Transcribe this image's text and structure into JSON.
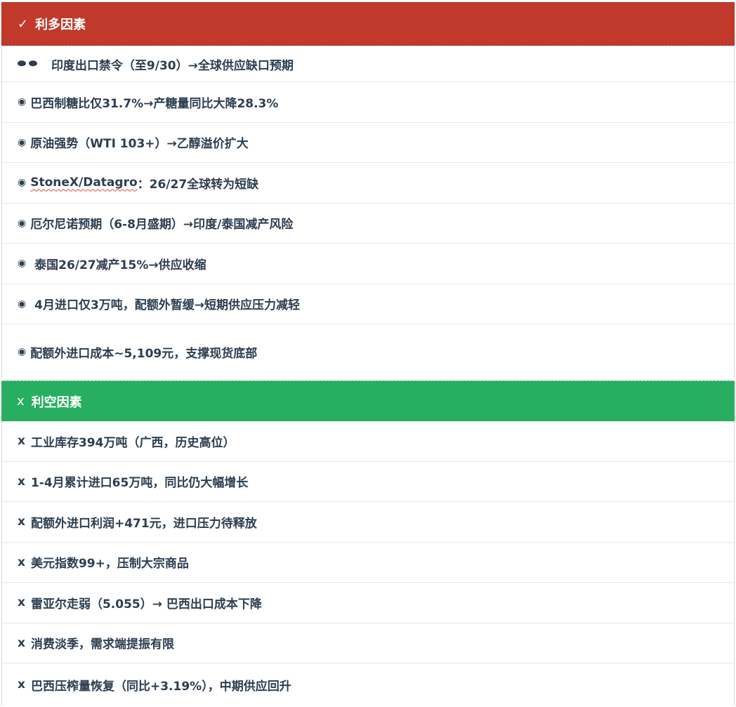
{
  "bullish": {
    "header_icon": "✅",
    "header_icon_name": "check-icon",
    "title": "利多因素",
    "color": "#c0392b",
    "items": [
      {
        "bullet": "👁👁",
        "prefix": "",
        "text": "印度出口禁令（至9/30）→全球供应缺口预期"
      },
      {
        "bullet": "◉",
        "prefix": "",
        "text": "巴西制糖比仅31.7%→产糖量同比大降28.3%"
      },
      {
        "bullet": "◉",
        "prefix": "",
        "text": "原油强势（WTI 103+）→乙醇溢价扩大"
      },
      {
        "bullet": "◉",
        "prefix": "StoneX/Datagro",
        "text": "：26/27全球转为短缺"
      },
      {
        "bullet": "◉",
        "prefix": "",
        "text": "厄尔尼诺预期（6-8月盛期）→印度/泰国减产风险"
      },
      {
        "bullet": "◉",
        "prefix": "",
        "text": " 泰国26/27减产15%→供应收缩"
      },
      {
        "bullet": "◉",
        "prefix": "",
        "text": " 4月进口仅3万吨，配额外暂缓→短期供应压力减轻"
      },
      {
        "bullet": "◉",
        "prefix": "",
        "text": "配额外进口成本~5,109元，支撑现货底部"
      }
    ]
  },
  "bearish": {
    "header_icon": "x",
    "title": "利空因素",
    "color": "#27ae60",
    "items": [
      {
        "mark": "x",
        "text": "工业库存394万吨（广西，历史高位）"
      },
      {
        "mark": "x",
        "text": "1-4月累计进口65万吨，同比仍大幅增长"
      },
      {
        "mark": "x",
        "text": "配额外进口利润+471元，进口压力待释放"
      },
      {
        "mark": "x",
        "text": "美元指数99+，压制大宗商品"
      },
      {
        "mark": "x",
        "text": "雷亚尔走弱（5.055）→ 巴西出口成本下降"
      },
      {
        "mark": "x",
        "text": "消费淡季，需求端提振有限"
      },
      {
        "mark": "x",
        "text": "巴西压榨量恢复（同比+3.19%），中期供应回升"
      }
    ]
  }
}
